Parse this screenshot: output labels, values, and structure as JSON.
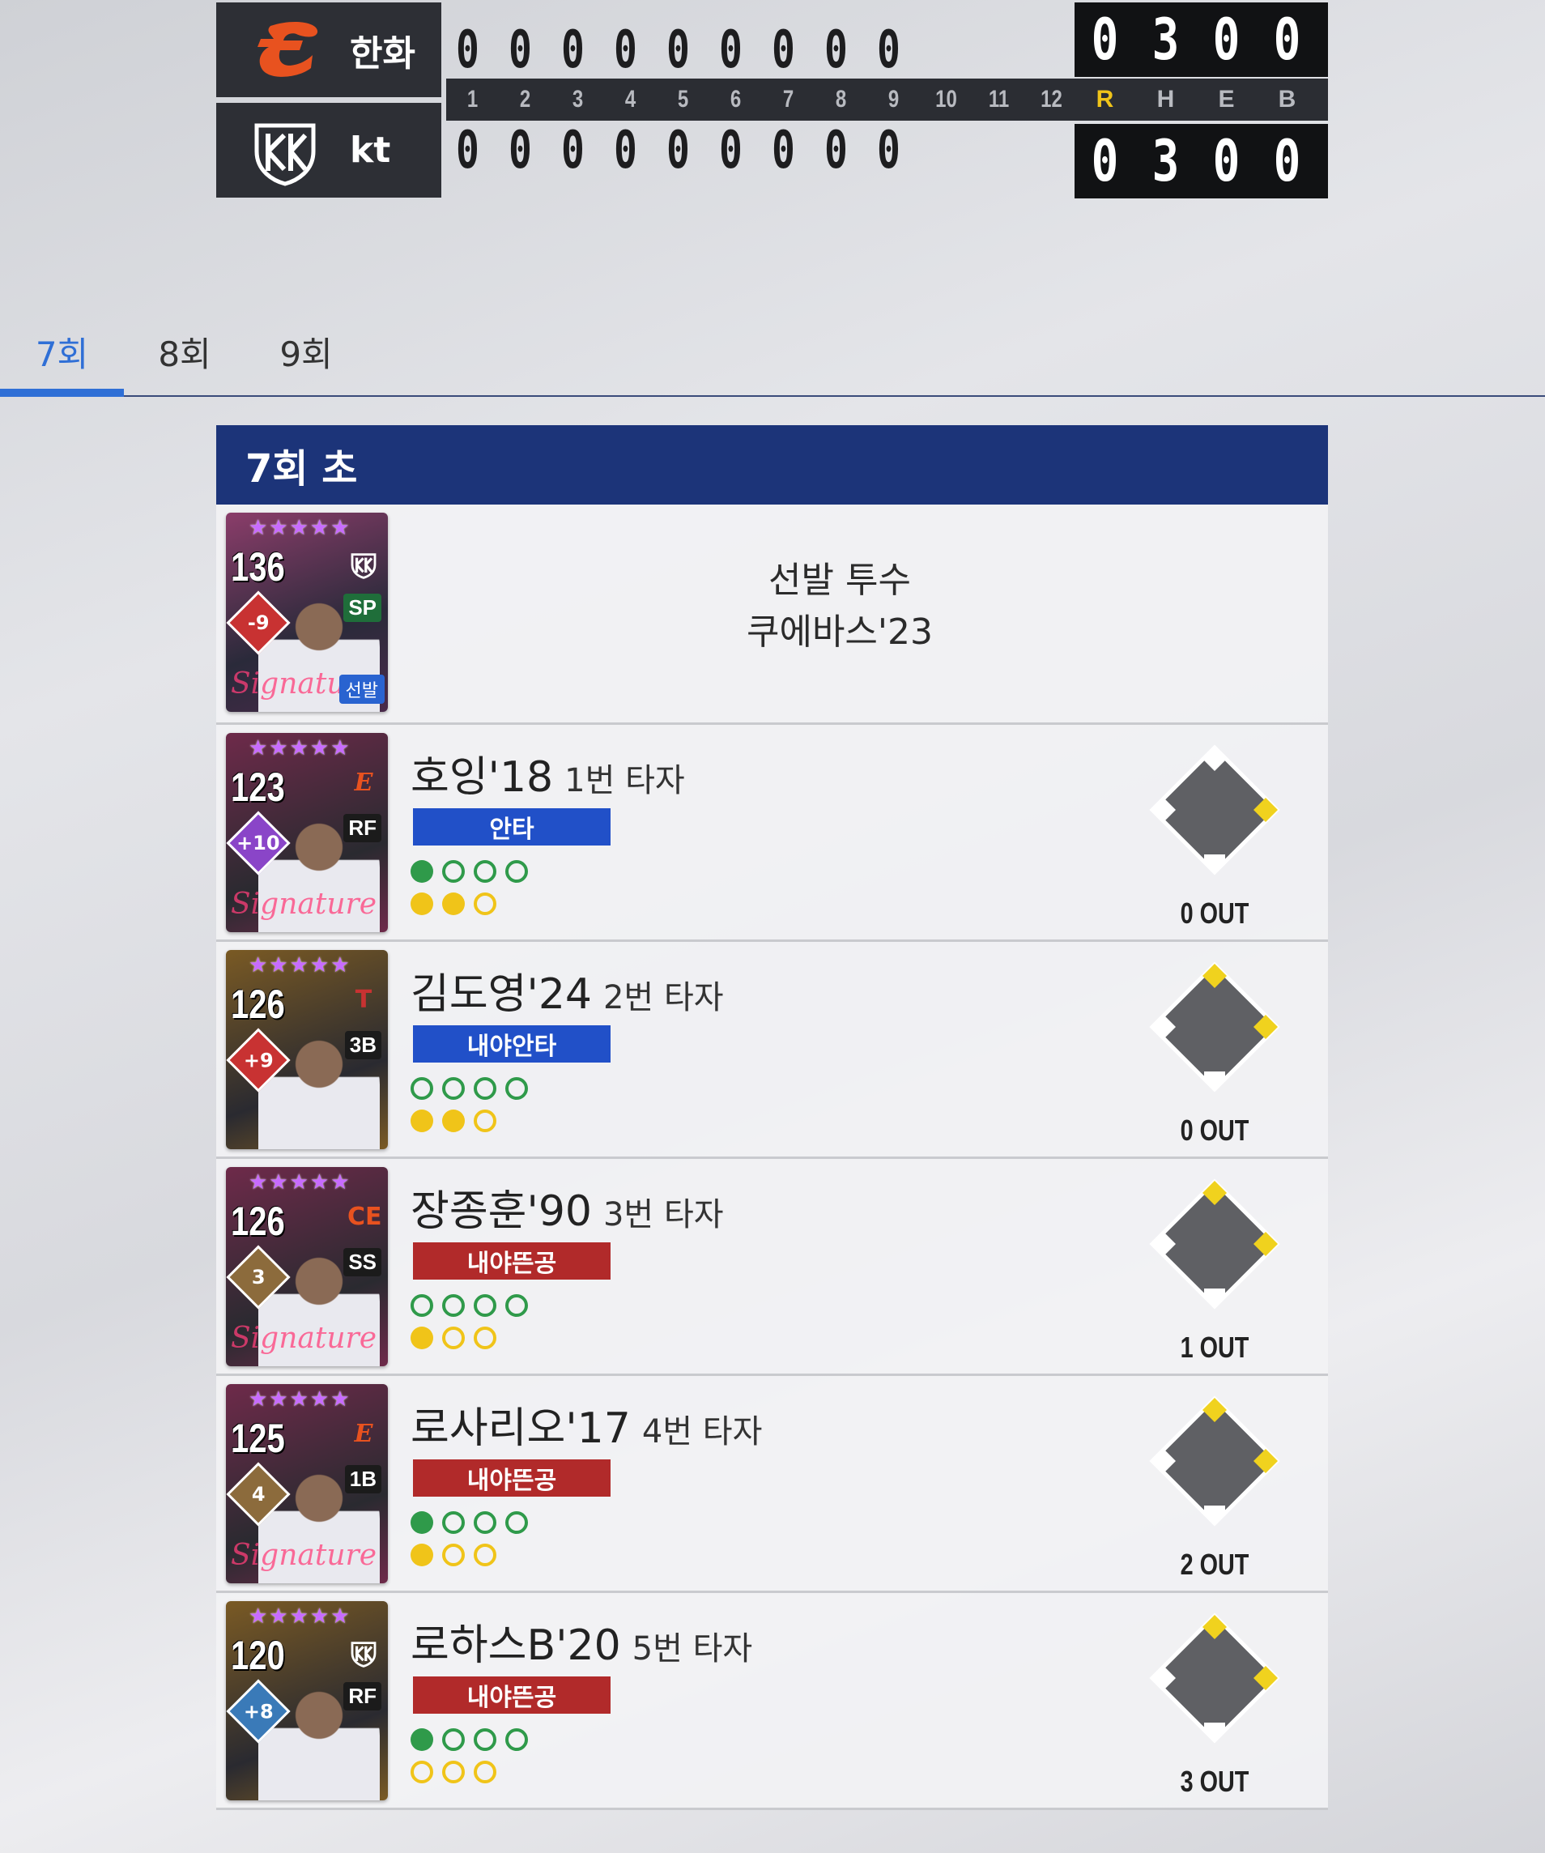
{
  "scoreboard": {
    "away": {
      "name": "한화",
      "innings": [
        "0",
        "0",
        "0",
        "0",
        "0",
        "0",
        "0",
        "0",
        "0"
      ],
      "totals": [
        "0",
        "3",
        "0",
        "0"
      ]
    },
    "home": {
      "name": "kt",
      "innings": [
        "0",
        "0",
        "0",
        "0",
        "0",
        "0",
        "0",
        "0",
        "0"
      ],
      "totals": [
        "0",
        "3",
        "0",
        "0"
      ]
    },
    "inning_headers": [
      "1",
      "2",
      "3",
      "4",
      "5",
      "6",
      "7",
      "8",
      "9",
      "10",
      "11",
      "12"
    ],
    "total_headers": [
      "R",
      "H",
      "E",
      "B"
    ]
  },
  "tabs": [
    {
      "label": "7회",
      "active": true
    },
    {
      "label": "8회",
      "active": false
    },
    {
      "label": "9회",
      "active": false
    }
  ],
  "half_inning": {
    "title": "7회 초",
    "pitcher": {
      "role": "선발 투수",
      "name": "쿠에바스'23",
      "card": {
        "ovr": "136",
        "position": "SP",
        "badge": "-9",
        "tag": "선발",
        "stars": "★★★★★",
        "signature": "Signature"
      }
    },
    "batters": [
      {
        "name": "호잉'18",
        "order": "1번 타자",
        "result": "안타",
        "result_type": "hit",
        "balls": [
          true,
          false,
          false,
          false
        ],
        "strikes": [
          true,
          true,
          false
        ],
        "outs": "0 OUT",
        "bases": {
          "first": true,
          "second": false,
          "third": false
        },
        "card": {
          "ovr": "123",
          "position": "RF",
          "badge": "+10",
          "stars": "★★★★★",
          "signature": "Signature",
          "badge_color": "#8a45c8",
          "bg": "#6e2a4a"
        }
      },
      {
        "name": "김도영'24",
        "order": "2번 타자",
        "result": "내야안타",
        "result_type": "hit",
        "balls": [
          false,
          false,
          false,
          false
        ],
        "strikes": [
          true,
          true,
          false
        ],
        "outs": "0 OUT",
        "bases": {
          "first": true,
          "second": true,
          "third": false
        },
        "card": {
          "ovr": "126",
          "position": "3B",
          "badge": "+9",
          "stars": "★★★★★",
          "signature": "",
          "badge_color": "#c83232",
          "bg": "#7a5a24"
        }
      },
      {
        "name": "장종훈'90",
        "order": "3번 타자",
        "result": "내야뜬공",
        "result_type": "out",
        "balls": [
          false,
          false,
          false,
          false
        ],
        "strikes": [
          true,
          false,
          false
        ],
        "outs": "1 OUT",
        "bases": {
          "first": true,
          "second": true,
          "third": false
        },
        "card": {
          "ovr": "126",
          "position": "SS",
          "badge": "3",
          "stars": "★★★★★",
          "signature": "Signature",
          "badge_color": "#8c6b3c",
          "bg": "#6e2a4a"
        }
      },
      {
        "name": "로사리오'17",
        "order": "4번 타자",
        "result": "내야뜬공",
        "result_type": "out",
        "balls": [
          true,
          false,
          false,
          false
        ],
        "strikes": [
          true,
          false,
          false
        ],
        "outs": "2 OUT",
        "bases": {
          "first": true,
          "second": true,
          "third": false
        },
        "card": {
          "ovr": "125",
          "position": "1B",
          "badge": "4",
          "stars": "★★★★★",
          "signature": "Signature",
          "badge_color": "#8c6b3c",
          "bg": "#6e2a4a"
        }
      },
      {
        "name": "로하스B'20",
        "order": "5번 타자",
        "result": "내야뜬공",
        "result_type": "out",
        "balls": [
          true,
          false,
          false,
          false
        ],
        "strikes": [
          false,
          false,
          false
        ],
        "outs": "3 OUT",
        "bases": {
          "first": true,
          "second": true,
          "third": false
        },
        "card": {
          "ovr": "120",
          "position": "RF",
          "badge": "+8",
          "stars": "★★★★★",
          "signature": "",
          "badge_color": "#3a7ab8",
          "bg": "#7a5a24"
        }
      }
    ]
  },
  "colors": {
    "accent_tab": "#2f6fd6",
    "panel_header": "#1c3479",
    "hit_tag": "#2150c8",
    "out_tag": "#b12a2a",
    "ball_green": "#2f9a4a",
    "strike_yellow": "#f0c419",
    "runs_header": "#f0c419"
  },
  "icons": {
    "away_logo": "hanwha-eagles-logo",
    "home_logo": "kt-wiz-logo",
    "base_diamond": "base-diamond-icon"
  }
}
